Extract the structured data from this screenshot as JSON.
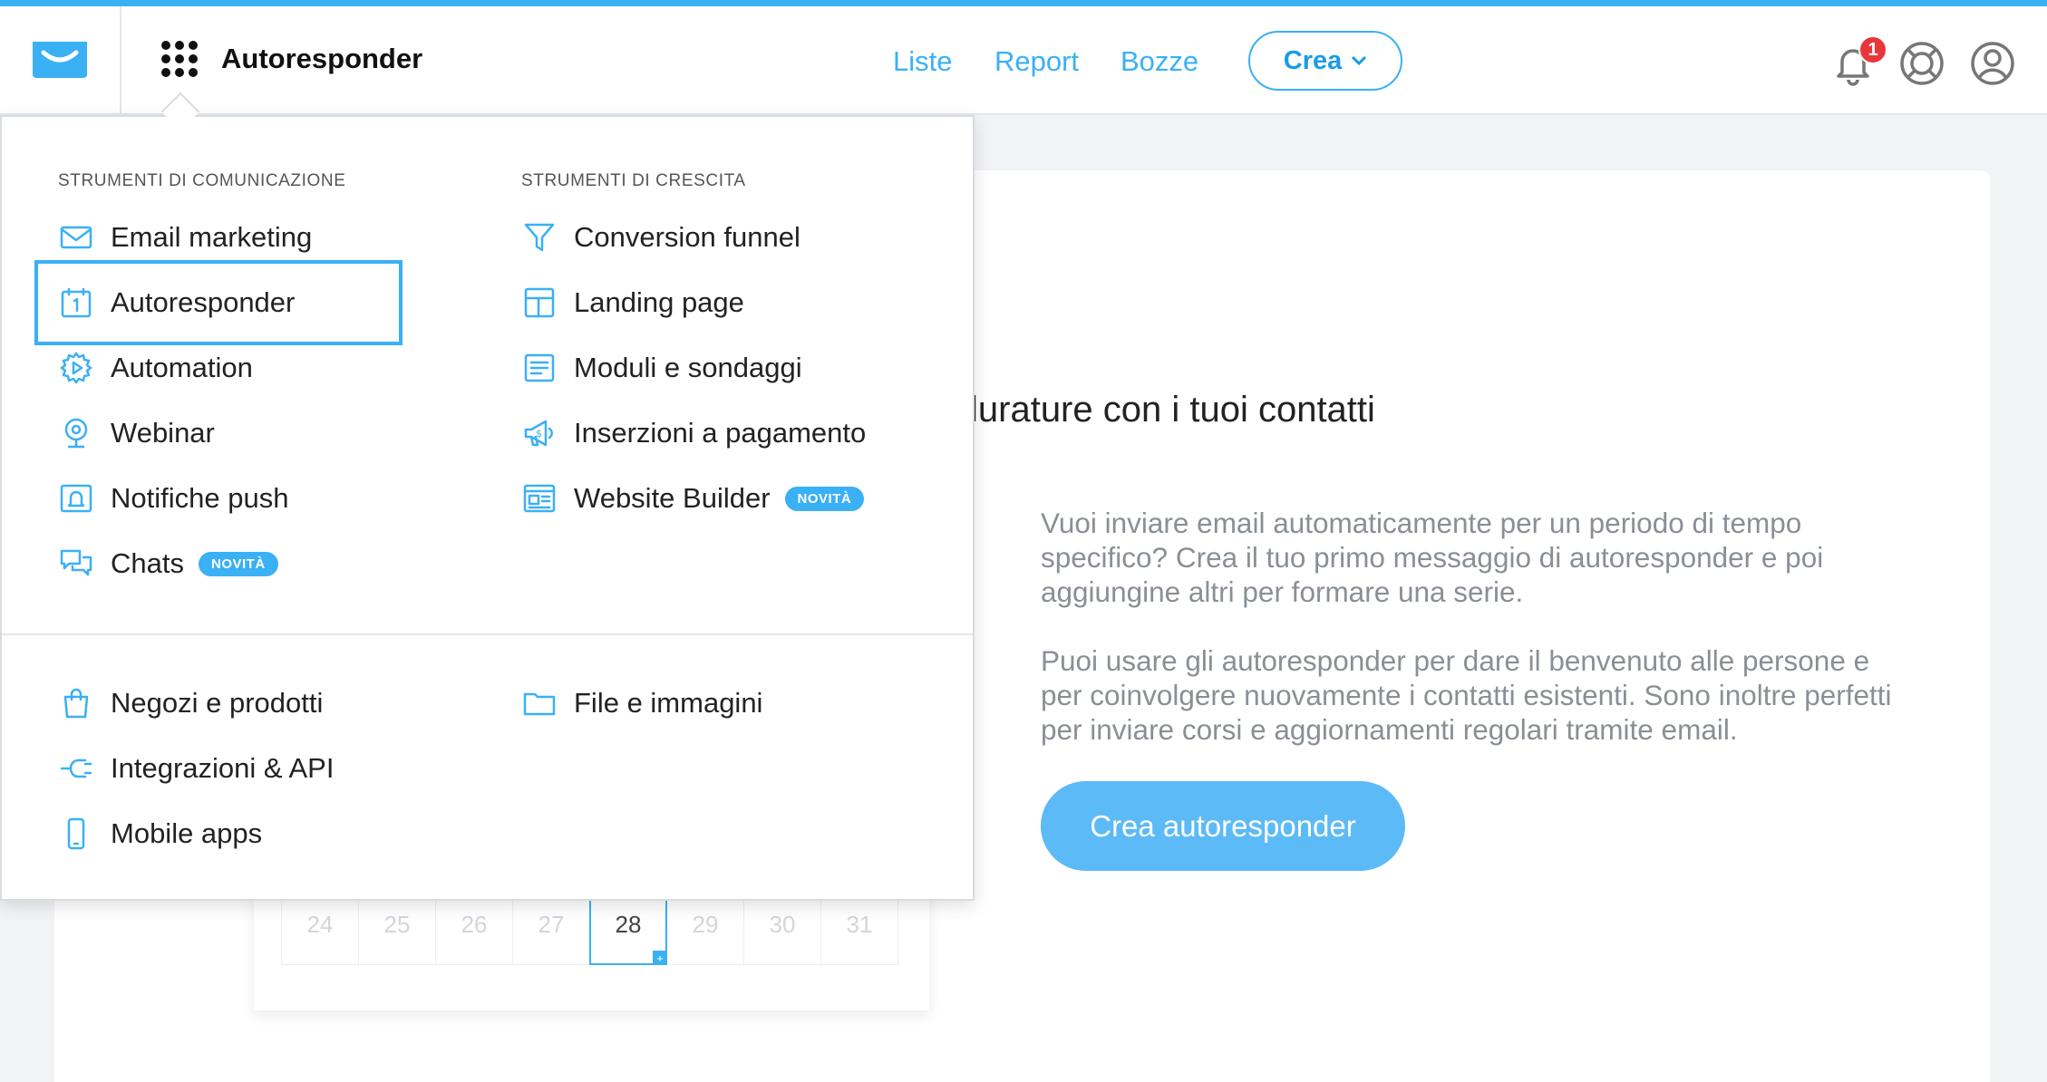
{
  "header": {
    "app_title": "Autoresponder",
    "nav": [
      "Liste",
      "Report",
      "Bozze"
    ],
    "create_label": "Crea",
    "notification_count": "1",
    "accent_color": "#3ab0f5",
    "badge_color": "#e8363b"
  },
  "menu": {
    "communication_title": "STRUMENTI DI COMUNICAZIONE",
    "growth_title": "STRUMENTI DI CRESCITA",
    "communication_items": [
      {
        "label": "Email marketing",
        "icon": "envelope-icon"
      },
      {
        "label": "Autoresponder",
        "icon": "calendar-icon",
        "selected": true
      },
      {
        "label": "Automation",
        "icon": "automation-gear-icon"
      },
      {
        "label": "Webinar",
        "icon": "webcam-icon"
      },
      {
        "label": "Notifiche push",
        "icon": "push-bell-icon"
      },
      {
        "label": "Chats",
        "icon": "chat-bubbles-icon",
        "badge": "NOVITÀ"
      }
    ],
    "growth_items": [
      {
        "label": "Conversion funnel",
        "icon": "funnel-icon"
      },
      {
        "label": "Landing page",
        "icon": "layout-icon"
      },
      {
        "label": "Moduli e sondaggi",
        "icon": "form-icon"
      },
      {
        "label": "Inserzioni a pagamento",
        "icon": "megaphone-icon"
      },
      {
        "label": "Website Builder",
        "icon": "website-icon",
        "badge": "NOVITÀ"
      }
    ],
    "other_left": [
      {
        "label": "Negozi e prodotti",
        "icon": "shopping-bag-icon"
      },
      {
        "label": "Integrazioni & API",
        "icon": "plug-icon"
      },
      {
        "label": "Mobile apps",
        "icon": "mobile-icon"
      }
    ],
    "other_right": [
      {
        "label": "File e immagini",
        "icon": "folder-icon"
      }
    ]
  },
  "main": {
    "heading_fragment": "lurature con i tuoi contatti",
    "paragraph1": "Vuoi inviare email automaticamente per un periodo di tempo specifico? Crea il tuo primo messaggio di autoresponder e poi aggiungine altri per formare una serie.",
    "paragraph2": "Puoi usare gli autoresponder per dare il benvenuto alle persone e per coinvolgere nuovamente i contatti esistenti. Sono inoltre perfetti per inviare corsi e aggiornamenti regolari tramite email.",
    "cta_label": "Crea autoresponder",
    "calendar_days": [
      "24",
      "25",
      "26",
      "27",
      "28",
      "29",
      "30",
      "31"
    ],
    "calendar_highlight": "28"
  }
}
